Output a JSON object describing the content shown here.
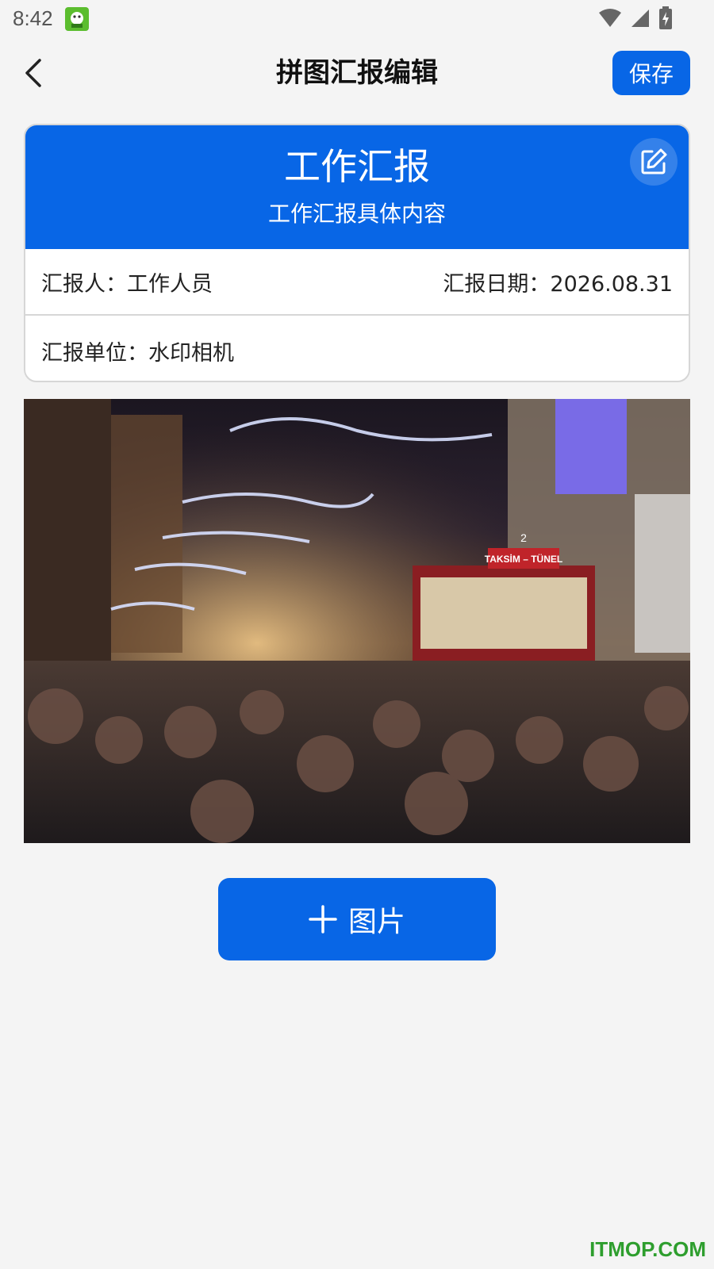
{
  "status_bar": {
    "time": "8:42",
    "icons": [
      "app-notification-icon",
      "wifi-icon",
      "signal-icon",
      "battery-charging-icon"
    ]
  },
  "header": {
    "title": "拼图汇报编辑",
    "save_label": "保存",
    "back_icon": "chevron-left-icon"
  },
  "report": {
    "title": "工作汇报",
    "subtitle": "工作汇报具体内容",
    "edit_icon": "edit-icon",
    "reporter": "汇报人：工作人员",
    "date": "汇报日期：2026.08.31",
    "unit": "汇报单位：水印相机"
  },
  "photo": {
    "sign_number": "2",
    "sign_text": "TAKSİM – TÜNEL"
  },
  "add_button": {
    "label": "图片",
    "icon": "plus-icon"
  },
  "watermark": "ITMOP.COM",
  "colors": {
    "primary": "#0866e6",
    "background": "#f4f4f4"
  }
}
